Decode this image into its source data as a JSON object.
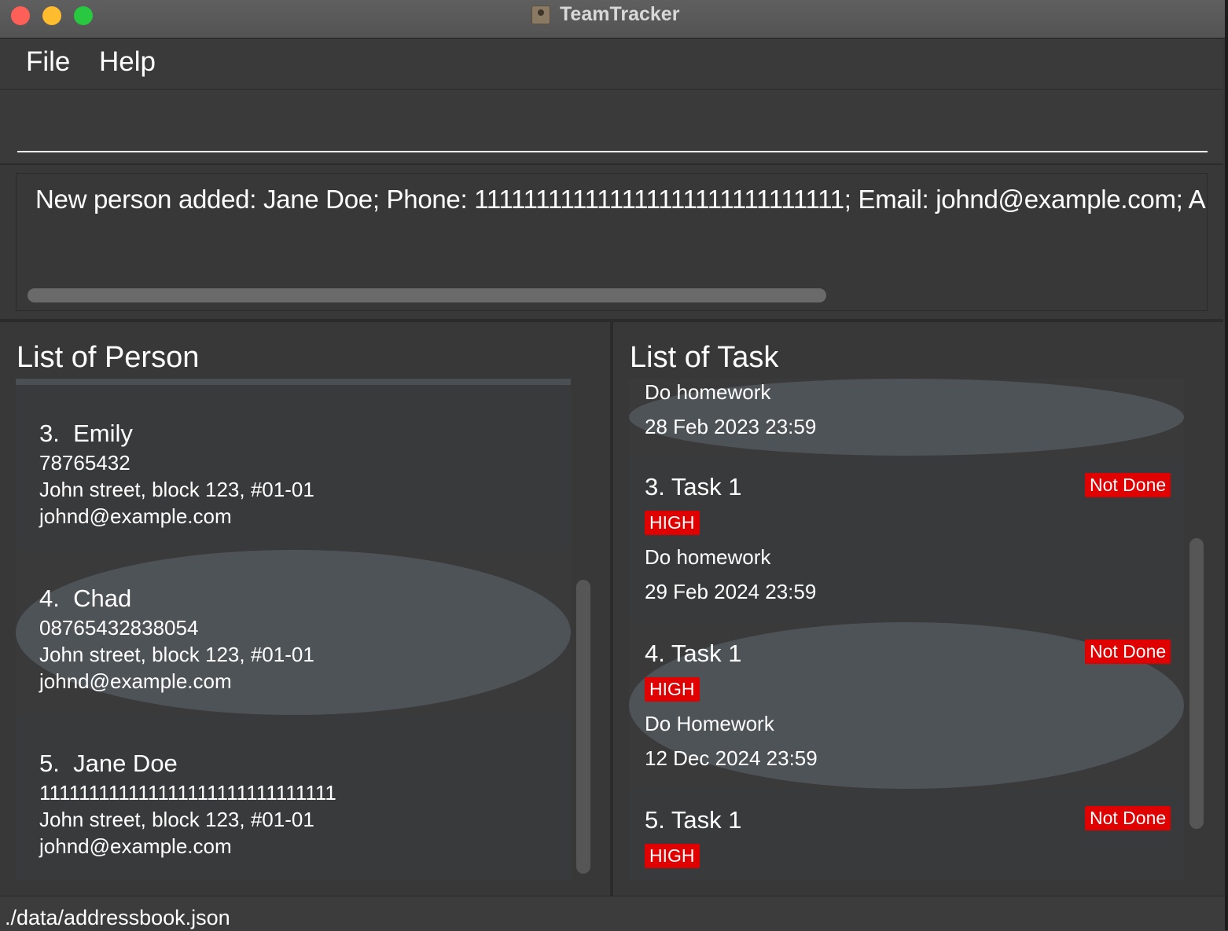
{
  "window": {
    "title": "TeamTracker"
  },
  "menu": {
    "file": "File",
    "help": "Help"
  },
  "command": {
    "value": ""
  },
  "result": {
    "text": "New person added: Jane Doe; Phone: 111111111111111111111111111111; Email: johnd@example.com; A"
  },
  "persons": {
    "title": "List of Person",
    "items": [
      {
        "index": "3.",
        "name": "Emily",
        "phone": "78765432",
        "address": "John street, block 123, #01-01",
        "email": "johnd@example.com"
      },
      {
        "index": "4.",
        "name": "Chad",
        "phone": "08765432838054",
        "address": "John street, block 123, #01-01",
        "email": "johnd@example.com"
      },
      {
        "index": "5.",
        "name": "Jane Doe",
        "phone": "111111111111111111111111111111",
        "address": "John street, block 123, #01-01",
        "email": "johnd@example.com"
      }
    ]
  },
  "tasks": {
    "title": "List of Task",
    "partial": {
      "description": "Do homework",
      "deadline": "28 Feb 2023 23:59"
    },
    "items": [
      {
        "title": "3. Task 1",
        "status": "Not Done",
        "priority": "HIGH",
        "description": "Do homework",
        "deadline": "29 Feb 2024 23:59"
      },
      {
        "title": "4. Task 1",
        "status": "Not Done",
        "priority": "HIGH",
        "description": "Do Homework",
        "deadline": "12 Dec 2024 23:59"
      },
      {
        "title": "5. Task 1",
        "status": "Not Done",
        "priority": "HIGH"
      }
    ]
  },
  "status": {
    "path": "./data/addressbook.json"
  },
  "colors": {
    "badge": "#e10000",
    "selected_card": "#4e5358",
    "card": "#393a3c",
    "background": "#383838"
  }
}
